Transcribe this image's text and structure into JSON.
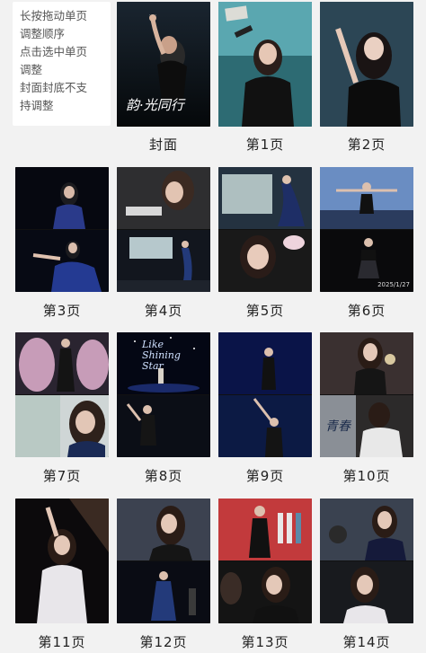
{
  "tip": {
    "lines": [
      "长按拖动单页",
      "调整顺序",
      "点击选中单页",
      "调整",
      "封面封底不支",
      "持调整"
    ]
  },
  "cover": {
    "label": "封面",
    "title_text": "韵·光同行"
  },
  "pages": [
    {
      "label": "第1页"
    },
    {
      "label": "第2页"
    },
    {
      "label": "第3页"
    },
    {
      "label": "第4页"
    },
    {
      "label": "第5页"
    },
    {
      "label": "第6页"
    },
    {
      "label": "第7页"
    },
    {
      "label": "第8页"
    },
    {
      "label": "第9页"
    },
    {
      "label": "第10页"
    },
    {
      "label": "第11页"
    },
    {
      "label": "第12页"
    },
    {
      "label": "第13页"
    },
    {
      "label": "第14页"
    }
  ],
  "overlay_text": {
    "shining_star": "Like\nShining\nStar",
    "stamp_p6": "2025/1/27",
    "banner_p10": "青春"
  },
  "colors": {
    "background": "#f2f2f2",
    "label": "#222222",
    "tip_text": "#555555"
  }
}
